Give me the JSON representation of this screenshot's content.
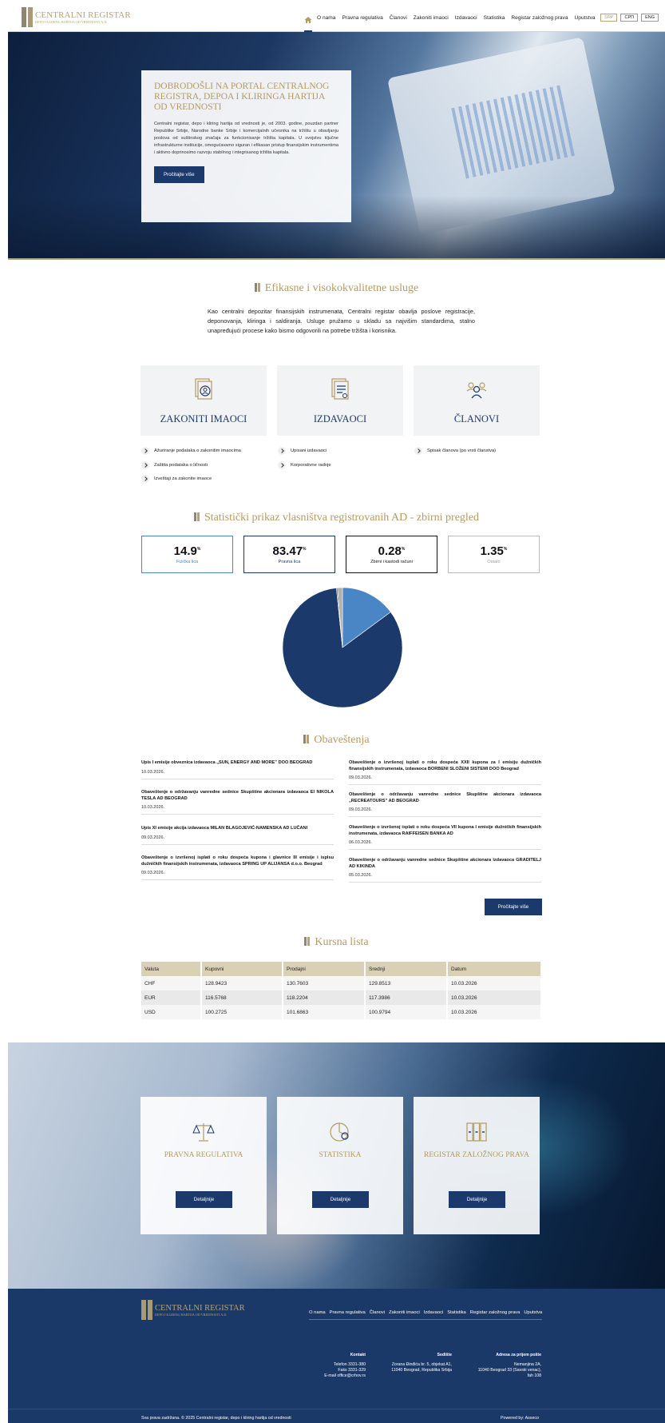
{
  "header": {
    "logo_title": "CENTRALNI REGISTAR",
    "logo_sub": "DEPO I KLIRING HARTIJA OD VREDNOSTI A.D.",
    "nav": [
      "O nama",
      "Pravna regulativa",
      "Članovi",
      "Zakoniti imaoci",
      "Izdavaoci",
      "Statistika",
      "Registar založnog prava",
      "Uputstva"
    ],
    "langs": [
      "SRP",
      "СРП",
      "ENG"
    ]
  },
  "hero": {
    "title": "DOBRODOŠLI NA PORTAL CENTRALNOG REGISTRA, DEPOA I KLIRINGA HARTIJA OD VREDNOSTI",
    "text": "Centralni registar, depo i kliring hartija od vrednosti je, od 2003. godine, pouzdan partner Republike Srbije, Narodne banke Srbije i komercijalnih učesnika na tržištu u obavljanju poslova od suštinskog značaja za funkcionisanje tržišta kapitala. U svojstvu ključne infrastrukturne institucije, omogućavamo siguran i efikasan pristup finansijskim instrumentima i aktivno doprinosimo razvoju stabilnog i integrisanog tržišta kapitala.",
    "button": "Pročitajte više"
  },
  "services": {
    "title": "Efikasne i visokokvalitetne usluge",
    "intro": "Kao centralni depozitar finansijskih instrumenata, Centralni registar obavlja poslove registracije, deponovanja, kliringa i saldiranja. Usluge pružamo u skladu sa najvišim standardima, stalno unapređujući procese kako bismo odgovorili na potrebe tržišta i korisnika.",
    "cards": [
      {
        "label": "ZAKONITI IMAOCI",
        "icon": "document-user-icon",
        "links": [
          "Ažuriranje podataka o zakonitim imaocima",
          "Zaštita podataka o ličnosti",
          "Izveštaji za zakonite imaoce"
        ]
      },
      {
        "label": "IZDAVAOCI",
        "icon": "documents-icon",
        "links": [
          "Upisani izdavaoci",
          "Korporativne radnje"
        ]
      },
      {
        "label": "ČLANOVI",
        "icon": "users-icon",
        "links": [
          "Spisak članova (po vrsti članstva)"
        ]
      }
    ]
  },
  "stats": {
    "title": "Statistički prikaz vlasništva registrovanih AD - zbirni pregled",
    "items": [
      {
        "value": "14.9",
        "unit": "%",
        "label": "Fizička lica",
        "color": "#4a86c5"
      },
      {
        "value": "83.47",
        "unit": "%",
        "label": "Pravna lica",
        "color": "#1b3a6b"
      },
      {
        "value": "0.28",
        "unit": "%",
        "label": "Zbirni i kastodi računi",
        "color": "#111111"
      },
      {
        "value": "1.35",
        "unit": "%",
        "label": "Ostalo",
        "color": "#9a9a9a"
      }
    ]
  },
  "chart_data": {
    "type": "pie",
    "categories": [
      "Fizička lica",
      "Pravna lica",
      "Zbirni i kastodi računi",
      "Ostalo"
    ],
    "values": [
      14.9,
      83.47,
      0.28,
      1.35
    ],
    "colors": [
      "#4a86c5",
      "#1b3a6b",
      "#333333",
      "#b0b0b0"
    ]
  },
  "news": {
    "title": "Obaveštenja",
    "left": [
      {
        "title": "Upis I emisije obveznica izdavaoca „SUN, ENERGY AND MORE” DOO BEOGRAD",
        "date": "10.03.2026."
      },
      {
        "title": "Obaveštenje o održavanju vanredne sednice Skupštine akcionara izdavaoca EI NIKOLA TESLA AD BEOGRAD",
        "date": "10.03.2026."
      },
      {
        "title": "Upis XI emisije akcija izdavaoca MILAN BLAGOJEVIĆ-NAMENSKA AD LUČANI",
        "date": "09.03.2026."
      },
      {
        "title": "Obaveštenje o izvršenoj isplati o roku dospeća kupona i glavnice III emisije i isplsu dužničkih finansijskih instrumenata, izdavaoca SPRING UP ALIJANSA d.o.o. Beograd",
        "date": "09.03.2026."
      }
    ],
    "right": [
      {
        "title": "Obaveštenje o izvršenoj isplati o roku dospeća XXII kupona za I emisiju dužničkih finansijskih instrumenata, izdavaoca BORBENI SLOŽENI SISTEMI DOO Beograd",
        "date": "09.03.2026."
      },
      {
        "title": "Obaveštenje o održavanju vanredne sednice Skupštine akcionara izdavaoca „RECREATOURS” AD BEOGRAD",
        "date": "09.03.2026."
      },
      {
        "title": "Obaveštenje o izvršenoj isplati o roku dospeća VII kupona I emisije dužničkih finansijskih instrumenata, izdavaoca RAIFFEISEN BANKA AD",
        "date": "06.03.2026."
      },
      {
        "title": "Obaveštenje o održavanju vanredne sednice Skupštine akcionara izdavaoca GRADITELJ AD KIKINDA",
        "date": "05.03.2026."
      }
    ],
    "button": "Pročitajte više"
  },
  "rates": {
    "title": "Kursna lista",
    "headers": [
      "Valuta",
      "Kupovni",
      "Prodajni",
      "Srednji",
      "Datum"
    ],
    "rows": [
      [
        "CHF",
        "128.9423",
        "130.7603",
        "129.8513",
        "10.03.2026"
      ],
      [
        "EUR",
        "116.5768",
        "118.2204",
        "117.3986",
        "10.03.2026"
      ],
      [
        "USD",
        "100.2725",
        "101.6863",
        "100.9794",
        "10.03.2026"
      ]
    ]
  },
  "features": [
    {
      "label": "PRAVNA REGULATIVA",
      "icon": "scales-icon",
      "button": "Detaljnije"
    },
    {
      "label": "STATISTIKA",
      "icon": "pie-chart-icon",
      "button": "Detaljnije"
    },
    {
      "label": "REGISTAR ZALOŽNOG PRAVA",
      "icon": "binders-icon",
      "button": "Detaljnije"
    }
  ],
  "footer": {
    "logo_title": "CENTRALNI REGISTAR",
    "logo_sub": "DEPO I KLIRING HARTIJA OD VREDNOSTI A.D.",
    "nav": [
      "O nama",
      "Pravna regulativa",
      "Članovi",
      "Zakoniti imaoci",
      "Izdavaoci",
      "Statistika",
      "Registar založnog prava",
      "Uputstva"
    ],
    "contact": {
      "title": "Kontakt",
      "lines": [
        "Telefon 3331-380",
        "Faks 3331-329",
        "E-mail office@crhov.rs"
      ]
    },
    "seat": {
      "title": "Sedište",
      "lines": [
        "Zorana Đinđića br. 5, objekat A1,",
        "11040 Beograd, Republika Srbija"
      ]
    },
    "mail": {
      "title": "Adresa za prijem pošte",
      "lines": [
        "Nemanjina 2A,",
        "11040 Beograd 33 (Savski venac),",
        "fah 108"
      ]
    },
    "copyright": "Sva prava zadržana. © 2025 Centralni registar, depo i kliring hartija od vrednosti",
    "powered": "Powered by: Asseco"
  }
}
